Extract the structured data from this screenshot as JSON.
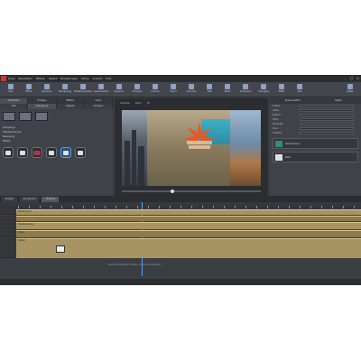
{
  "window": {
    "title": "",
    "menu": [
      "Datei",
      "Bearbeiten",
      "Effekte",
      "Objekt",
      "Einstellungen",
      "Extras",
      "Ansicht",
      "Hilfe"
    ],
    "controls": [
      "–",
      "□",
      "✕"
    ]
  },
  "toolbar": {
    "buttons": [
      "Neu",
      "Öffnen",
      "Speichern",
      "Rückgängig",
      "Wiederherstellen",
      "Ausschneiden",
      "Kopieren",
      "Einfügen",
      "Löschen",
      "Export",
      "Vorschau",
      "Titel",
      "Musik",
      "Aufnahme",
      "Übergang",
      "Effekt",
      "Text",
      "Weiter"
    ]
  },
  "left_panel": {
    "tabs": [
      "Mediathek",
      "Vorlagen",
      "Effekte",
      "Audio"
    ],
    "subtabs": [
      "Titel",
      "Übergänge",
      "Objekte",
      "Vorlagen"
    ],
    "tree_items": [
      "Übergänge",
      "Überblendungen",
      "Bewegung",
      "Effekte"
    ],
    "effects_header": ""
  },
  "preview": {
    "controls": [
      "Vorschau",
      "Zoom",
      "Fit"
    ],
    "time": ""
  },
  "right_panel": {
    "tabs": [
      "Eigenschaften",
      "Objekt"
    ],
    "props": [
      "Position",
      "Größe",
      "Rotation",
      "Farbe",
      "Deckkraft",
      "Rand",
      "Schatten"
    ],
    "cards": [
      "Überblendung",
      "Weiß"
    ],
    "section": "Eigenschaften"
  },
  "timeline": {
    "tabs": [
      "Projekt",
      "Storyboard",
      "Timeline"
    ],
    "tracks": [
      {
        "label": "Hintergrund"
      },
      {
        "label": "Überblendung"
      },
      {
        "label": "Video"
      },
      {
        "label": "Objekt"
      }
    ],
    "drop_hint": "Ziehen Sie Dateien hierher, um sie hinzuzufügen"
  },
  "status": {
    "left": "",
    "right": ""
  }
}
